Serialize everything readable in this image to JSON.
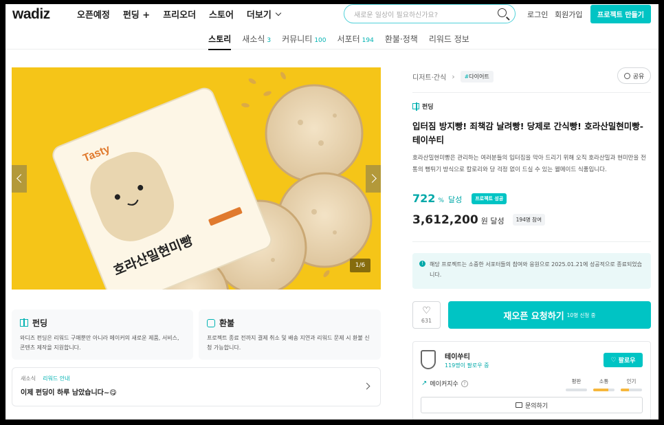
{
  "header": {
    "logo": "wadiz",
    "nav": [
      "오픈예정",
      "펀딩 +",
      "프리오더",
      "스토어",
      "더보기"
    ],
    "search_placeholder": "새로운 일상이 필요하신가요?",
    "login": "로그인",
    "signup": "회원가입",
    "make_project": "프로젝트 만들기"
  },
  "tabs": [
    {
      "label": "스토리",
      "count": ""
    },
    {
      "label": "새소식",
      "count": "3"
    },
    {
      "label": "커뮤니티",
      "count": "100"
    },
    {
      "label": "서포터",
      "count": "194"
    },
    {
      "label": "환불·정책",
      "count": ""
    },
    {
      "label": "리워드 정보",
      "count": ""
    }
  ],
  "gallery": {
    "counter": "1/6",
    "package_brand": "Tasty",
    "package_title": "호라산밀현미빵"
  },
  "info_cards": [
    {
      "title": "펀딩",
      "icon": "gift-icon",
      "text": "와디즈 펀딩은 리워드 구매뿐만 아니라 메이커의 새로운 제품, 서비스, 콘텐츠 제작을 지원합니다."
    },
    {
      "title": "환불",
      "icon": "clock-icon",
      "text": "프로젝트 종료 전까지 결제 취소 및 배송 지연과 리워드 문제 시 환불 신청 가능합니다."
    }
  ],
  "news": {
    "tag1": "새소식",
    "tag2": "리워드 안내",
    "title": "이제 펀딩이 하루 남았습니다~😋"
  },
  "project": {
    "category": "디저트·간식",
    "tag": "다이어트",
    "share": "공유",
    "funding_tag": "펀딩",
    "title": "입터짐 방지빵! 죄책감 날려빵! 당제로 간식빵! 호라산밀현미빵-테이쑤티",
    "summary": "호라산밀현미빵은 관리하는 여러분들의 입터짐을 막아 드리기 위해 오직 호라산밀과 현미만을 전통의 뻥튀기 방식으로 칼로리와 당 걱정 없이 드실 수 있는 웰메이드 식품입니다.",
    "percent": "722",
    "percent_unit": "%",
    "percent_label": "달성",
    "success_badge": "프로젝트 성공",
    "amount": "3,612,200",
    "amount_label": "원 달성",
    "backers": "194명 참여",
    "notice": "해당 프로젝트는 소중한 서포터들의 참여와 응원으로 2025.01.21에 성공적으로 종료되었습니다.",
    "likes": "631",
    "reopen_label": "재오픈 요청하기",
    "reopen_count": "10명 신청 중"
  },
  "maker": {
    "name": "테이쑤티",
    "followers": "119명이 팔로우 중",
    "follow": "팔로우",
    "index_label": "메이커지수",
    "stats": [
      {
        "label": "평판",
        "level": 0
      },
      {
        "label": "소통",
        "level": 0.7
      },
      {
        "label": "인기",
        "level": 0.4
      }
    ],
    "inquiry": "문의하기"
  },
  "colors": {
    "accent": "#00c4c4",
    "gallery_bg": "#f5c518"
  }
}
